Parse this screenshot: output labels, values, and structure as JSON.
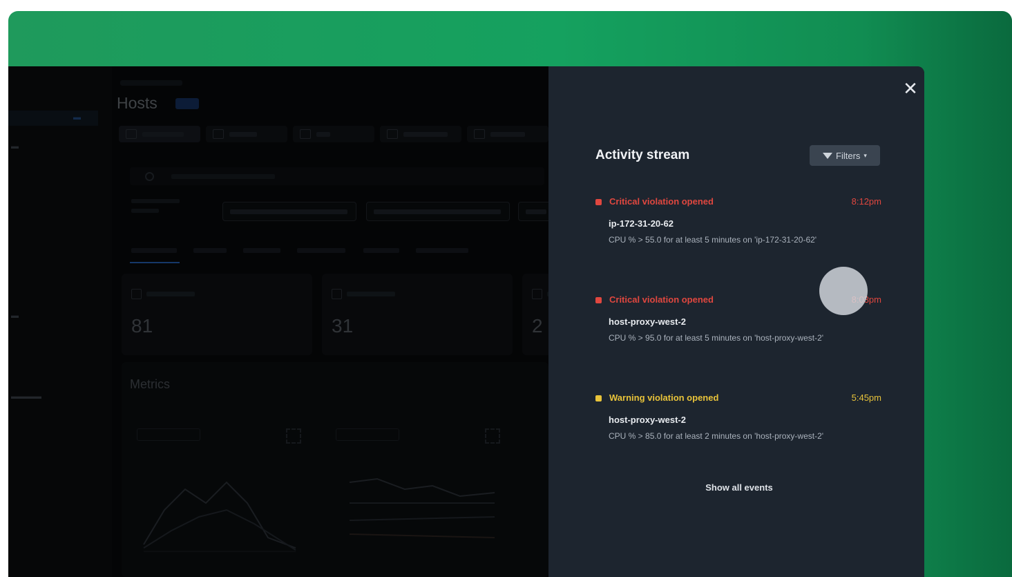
{
  "background_app": {
    "page_title": "Hosts",
    "summary_cards": [
      {
        "value": "81"
      },
      {
        "value": "31"
      },
      {
        "value": "2"
      }
    ],
    "metrics_title": "Metrics"
  },
  "activity_stream": {
    "title": "Activity stream",
    "filters_label": "Filters",
    "close_icon": "close-icon",
    "events": [
      {
        "severity": "critical",
        "type": "Critical violation opened",
        "time": "8:12pm",
        "host": "ip-172-31-20-62",
        "description": "CPU % > 55.0 for at least 5 minutes on 'ip-172-31-20-62'"
      },
      {
        "severity": "critical",
        "type": "Critical violation opened",
        "time": "8:03pm",
        "host": "host-proxy-west-2",
        "description": "CPU % > 95.0 for at least 5 minutes on 'host-proxy-west-2'"
      },
      {
        "severity": "warning",
        "type": "Warning violation opened",
        "time": "5:45pm",
        "host": "host-proxy-west-2",
        "description": "CPU % > 85.0 for at least 2 minutes on 'host-proxy-west-2'"
      }
    ],
    "show_all_label": "Show all events"
  },
  "colors": {
    "frame_green": "#15a15f",
    "drawer_bg": "#1d252f",
    "critical": "#e0473f",
    "warning": "#e8c33a"
  }
}
